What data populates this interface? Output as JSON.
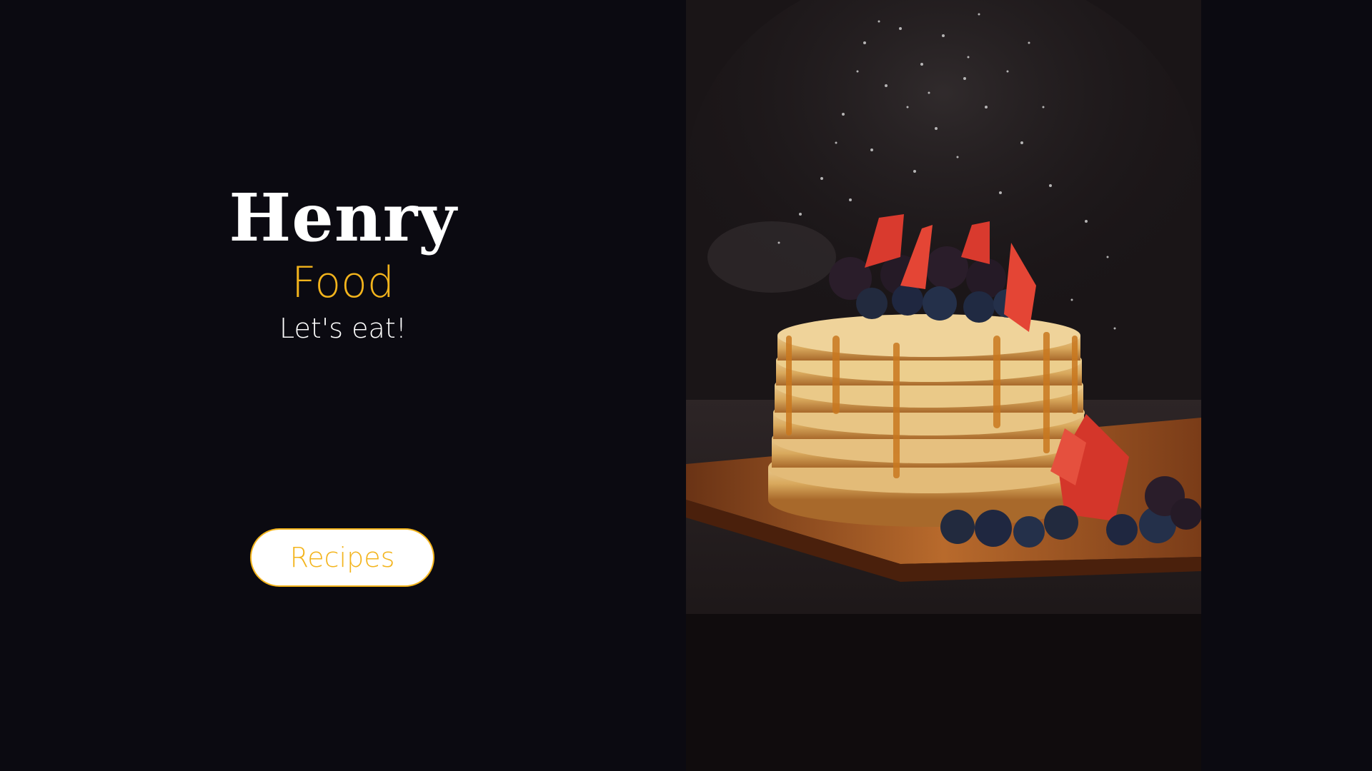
{
  "brand": {
    "title": "Henry",
    "subtitle": "Food",
    "tagline": "Let's eat!"
  },
  "cta": {
    "label": "Recipes"
  },
  "hero_image": {
    "subject": "stack of pancakes with berries, syrup and powdered sugar"
  },
  "colors": {
    "background": "#0b0a11",
    "accent": "#f3b41c",
    "text": "#ffffff"
  }
}
